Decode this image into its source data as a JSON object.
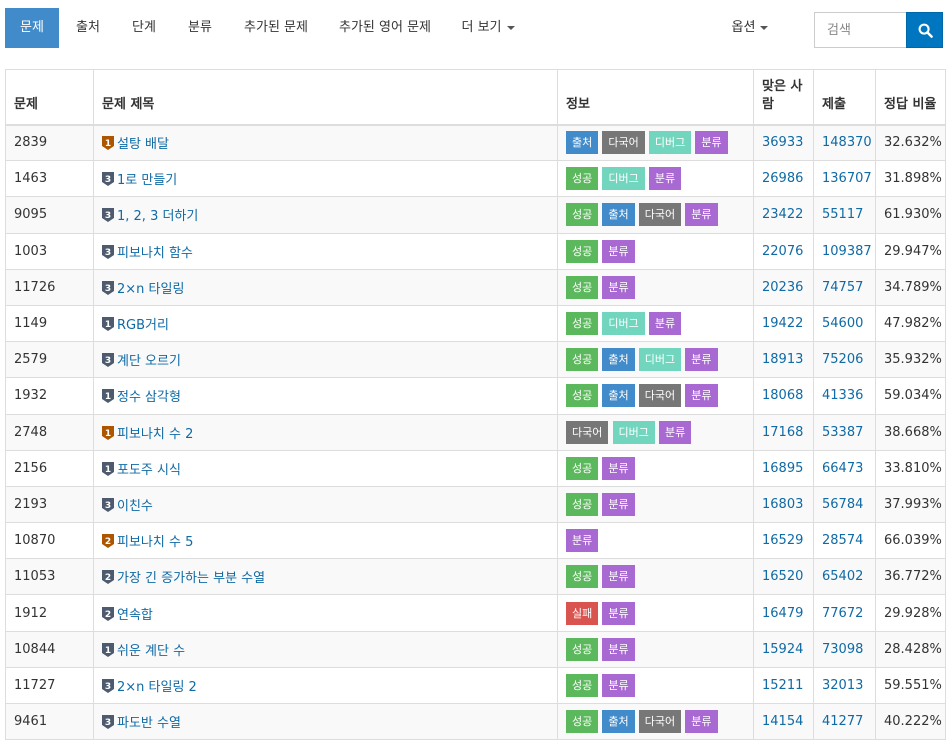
{
  "nav": {
    "tabs": [
      {
        "label": "문제",
        "active": true
      },
      {
        "label": "출처",
        "active": false
      },
      {
        "label": "단계",
        "active": false
      },
      {
        "label": "분류",
        "active": false
      },
      {
        "label": "추가된 문제",
        "active": false
      },
      {
        "label": "추가된 영어 문제",
        "active": false
      },
      {
        "label": "더 보기",
        "active": false
      }
    ],
    "options_label": "옵션",
    "search_placeholder": "검색"
  },
  "colors": {
    "accent": "#428bca",
    "search_button": "#0076c0",
    "link": "#0f6aa5",
    "label_success": "#5cb85c",
    "label_fail": "#d9534f",
    "label_source": "#428bca",
    "label_multilang": "#777777",
    "label_debug": "#72d6bf",
    "label_classify": "#a86ad2",
    "tier_silver": "#4e5b6f",
    "tier_bronze": "#ad5600"
  },
  "table": {
    "headers": [
      "문제",
      "문제 제목",
      "정보",
      "맞은 사람",
      "제출",
      "정답 비율"
    ],
    "rows": [
      {
        "id": "2839",
        "tier": "bronze",
        "level": "1",
        "title": "설탕 배달",
        "labels": [
          {
            "text": "출처",
            "kind": "source"
          },
          {
            "text": "다국어",
            "kind": "multi"
          },
          {
            "text": "디버그",
            "kind": "debug"
          },
          {
            "text": "분류",
            "kind": "class"
          }
        ],
        "solved": "36933",
        "submissions": "148370",
        "ratio": "32.632%"
      },
      {
        "id": "1463",
        "tier": "silver",
        "level": "3",
        "title": "1로 만들기",
        "labels": [
          {
            "text": "성공",
            "kind": "success"
          },
          {
            "text": "디버그",
            "kind": "debug"
          },
          {
            "text": "분류",
            "kind": "class"
          }
        ],
        "solved": "26986",
        "submissions": "136707",
        "ratio": "31.898%"
      },
      {
        "id": "9095",
        "tier": "silver",
        "level": "3",
        "title": "1, 2, 3 더하기",
        "labels": [
          {
            "text": "성공",
            "kind": "success"
          },
          {
            "text": "출처",
            "kind": "source"
          },
          {
            "text": "다국어",
            "kind": "multi"
          },
          {
            "text": "분류",
            "kind": "class"
          }
        ],
        "solved": "23422",
        "submissions": "55117",
        "ratio": "61.930%"
      },
      {
        "id": "1003",
        "tier": "silver",
        "level": "3",
        "title": "피보나치 함수",
        "labels": [
          {
            "text": "성공",
            "kind": "success"
          },
          {
            "text": "분류",
            "kind": "class"
          }
        ],
        "solved": "22076",
        "submissions": "109387",
        "ratio": "29.947%"
      },
      {
        "id": "11726",
        "tier": "silver",
        "level": "3",
        "title": "2×n 타일링",
        "labels": [
          {
            "text": "성공",
            "kind": "success"
          },
          {
            "text": "분류",
            "kind": "class"
          }
        ],
        "solved": "20236",
        "submissions": "74757",
        "ratio": "34.789%"
      },
      {
        "id": "1149",
        "tier": "silver",
        "level": "1",
        "title": "RGB거리",
        "labels": [
          {
            "text": "성공",
            "kind": "success"
          },
          {
            "text": "디버그",
            "kind": "debug"
          },
          {
            "text": "분류",
            "kind": "class"
          }
        ],
        "solved": "19422",
        "submissions": "54600",
        "ratio": "47.982%"
      },
      {
        "id": "2579",
        "tier": "silver",
        "level": "3",
        "title": "계단 오르기",
        "labels": [
          {
            "text": "성공",
            "kind": "success"
          },
          {
            "text": "출처",
            "kind": "source"
          },
          {
            "text": "디버그",
            "kind": "debug"
          },
          {
            "text": "분류",
            "kind": "class"
          }
        ],
        "solved": "18913",
        "submissions": "75206",
        "ratio": "35.932%"
      },
      {
        "id": "1932",
        "tier": "silver",
        "level": "1",
        "title": "정수 삼각형",
        "labels": [
          {
            "text": "성공",
            "kind": "success"
          },
          {
            "text": "출처",
            "kind": "source"
          },
          {
            "text": "다국어",
            "kind": "multi"
          },
          {
            "text": "분류",
            "kind": "class"
          }
        ],
        "solved": "18068",
        "submissions": "41336",
        "ratio": "59.034%"
      },
      {
        "id": "2748",
        "tier": "bronze",
        "level": "1",
        "title": "피보나치 수 2",
        "labels": [
          {
            "text": "다국어",
            "kind": "multi"
          },
          {
            "text": "디버그",
            "kind": "debug"
          },
          {
            "text": "분류",
            "kind": "class"
          }
        ],
        "solved": "17168",
        "submissions": "53387",
        "ratio": "38.668%"
      },
      {
        "id": "2156",
        "tier": "silver",
        "level": "1",
        "title": "포도주 시식",
        "labels": [
          {
            "text": "성공",
            "kind": "success"
          },
          {
            "text": "분류",
            "kind": "class"
          }
        ],
        "solved": "16895",
        "submissions": "66473",
        "ratio": "33.810%"
      },
      {
        "id": "2193",
        "tier": "silver",
        "level": "3",
        "title": "이친수",
        "labels": [
          {
            "text": "성공",
            "kind": "success"
          },
          {
            "text": "분류",
            "kind": "class"
          }
        ],
        "solved": "16803",
        "submissions": "56784",
        "ratio": "37.993%"
      },
      {
        "id": "10870",
        "tier": "bronze",
        "level": "2",
        "title": "피보나치 수 5",
        "labels": [
          {
            "text": "분류",
            "kind": "class"
          }
        ],
        "solved": "16529",
        "submissions": "28574",
        "ratio": "66.039%"
      },
      {
        "id": "11053",
        "tier": "silver",
        "level": "2",
        "title": "가장 긴 증가하는 부분 수열",
        "labels": [
          {
            "text": "성공",
            "kind": "success"
          },
          {
            "text": "분류",
            "kind": "class"
          }
        ],
        "solved": "16520",
        "submissions": "65402",
        "ratio": "36.772%"
      },
      {
        "id": "1912",
        "tier": "silver",
        "level": "2",
        "title": "연속합",
        "labels": [
          {
            "text": "실패",
            "kind": "fail"
          },
          {
            "text": "분류",
            "kind": "class"
          }
        ],
        "solved": "16479",
        "submissions": "77672",
        "ratio": "29.928%"
      },
      {
        "id": "10844",
        "tier": "silver",
        "level": "1",
        "title": "쉬운 계단 수",
        "labels": [
          {
            "text": "성공",
            "kind": "success"
          },
          {
            "text": "분류",
            "kind": "class"
          }
        ],
        "solved": "15924",
        "submissions": "73098",
        "ratio": "28.428%"
      },
      {
        "id": "11727",
        "tier": "silver",
        "level": "3",
        "title": "2×n 타일링 2",
        "labels": [
          {
            "text": "성공",
            "kind": "success"
          },
          {
            "text": "분류",
            "kind": "class"
          }
        ],
        "solved": "15211",
        "submissions": "32013",
        "ratio": "59.551%"
      },
      {
        "id": "9461",
        "tier": "silver",
        "level": "3",
        "title": "파도반 수열",
        "labels": [
          {
            "text": "성공",
            "kind": "success"
          },
          {
            "text": "출처",
            "kind": "source"
          },
          {
            "text": "다국어",
            "kind": "multi"
          },
          {
            "text": "분류",
            "kind": "class"
          }
        ],
        "solved": "14154",
        "submissions": "41277",
        "ratio": "40.222%"
      }
    ]
  }
}
